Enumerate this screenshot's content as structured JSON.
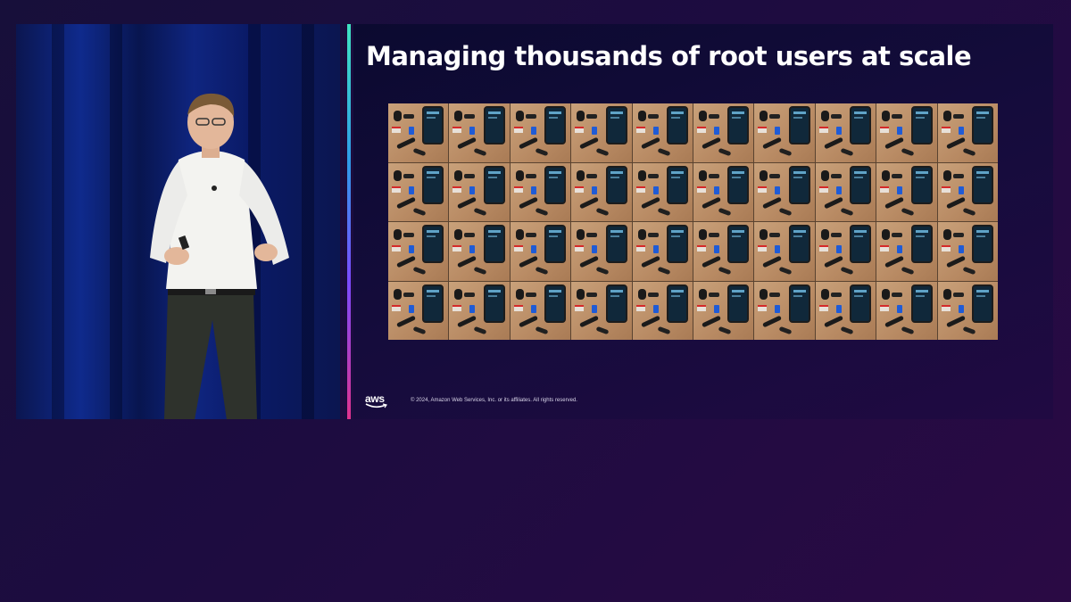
{
  "slide": {
    "title": "Managing thousands of root users at scale",
    "copyright": "© 2024, Amazon Web Services, Inc. or its affiliates. All rights reserved.",
    "logo": "aws",
    "grid": {
      "rows": 4,
      "columns": 10
    }
  },
  "colors": {
    "background": "#1d0c40",
    "divider_top": "#3fe3c0",
    "divider_bottom": "#e0338d",
    "title": "#ffffff"
  }
}
